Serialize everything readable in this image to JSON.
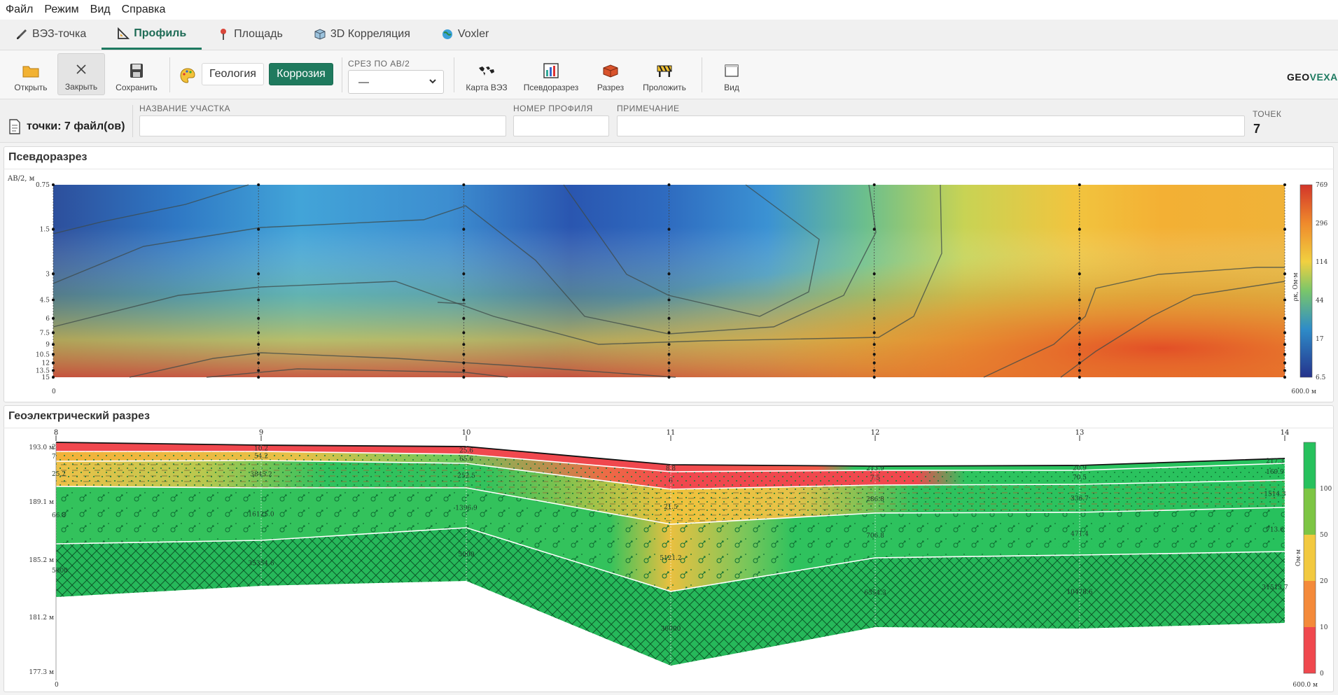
{
  "menu": [
    "Файл",
    "Режим",
    "Вид",
    "Справка"
  ],
  "tabs": [
    {
      "label": "ВЭЗ-точка",
      "icon": "brush-icon",
      "active": false
    },
    {
      "label": "Профиль",
      "icon": "triangle-ruler-icon",
      "active": true
    },
    {
      "label": "Площадь",
      "icon": "pin-icon",
      "active": false
    },
    {
      "label": "3D Корреляция",
      "icon": "cube-icon",
      "active": false
    },
    {
      "label": "Voxler",
      "icon": "globe-icon",
      "active": false
    }
  ],
  "toolbar": {
    "open": "Открыть",
    "close": "Закрыть",
    "save": "Сохранить",
    "geology": "Геология",
    "corrosion": "Коррозия",
    "srez_title": "СРЕЗ ПО AB/2",
    "srez_value": "—",
    "map": "Карта ВЭЗ",
    "pseudo": "Псевдоразрез",
    "razrez": "Разрез",
    "polozhit": "Проложить",
    "vid": "Вид"
  },
  "logo": {
    "a": "GEO",
    "b": "VEXA"
  },
  "info": {
    "points_label": "точки: 7 файл(ов)",
    "site_label": "НАЗВАНИЕ УЧАСТКА",
    "site_value": "",
    "profile_label": "НОМЕР ПРОФИЛЯ",
    "profile_value": "",
    "note_label": "ПРИМЕЧАНИЕ",
    "note_value": "",
    "count_label": "ТОЧЕК",
    "count_value": "7"
  },
  "colors": {
    "accent": "#1d7a60",
    "green": "#22c25e",
    "red": "#f0484e",
    "yellow": "#f2c940"
  },
  "pseudo": {
    "title": "Псевдоразрез",
    "y_axis_label": "AB/2, м",
    "y_ticks": [
      "0.75",
      "1.5",
      "3",
      "4.5",
      "6",
      "7.5",
      "9",
      "10.5",
      "12",
      "13.5",
      "15"
    ],
    "x_start": "0",
    "x_end": "600.0 м",
    "colorbar_ticks": [
      "769",
      "296",
      "114",
      "44",
      "17",
      "6.5"
    ],
    "colorbar_label": "ρк, Ом·м"
  },
  "geo": {
    "title": "Геоэлектрический разрез",
    "stations": [
      "8",
      "9",
      "10",
      "11",
      "12",
      "13",
      "14"
    ],
    "y_ticks": [
      "193.0 м",
      "189.1 м",
      "185.2 м",
      "181.2 м",
      "177.3 м"
    ],
    "x_start": "0",
    "x_end": "600.0 м",
    "legend_ticks": [
      "100",
      "50",
      "20",
      "10",
      "0"
    ],
    "legend_label": "Ом·м",
    "labels": [
      {
        "t": "10.2",
        "s": 1,
        "r": 0
      },
      {
        "t": "54.2",
        "s": 1,
        "r": 1
      },
      {
        "t": "3845.2",
        "s": 1,
        "r": 2
      },
      {
        "t": "16125.0",
        "s": 1,
        "r": 3
      },
      {
        "t": "35354.6",
        "s": 1,
        "r": 4
      },
      {
        "t": "25.6",
        "s": 2,
        "r": 0
      },
      {
        "t": "65.6",
        "s": 2,
        "r": 1
      },
      {
        "t": "252.5",
        "s": 2,
        "r": 2
      },
      {
        "t": "1396.9",
        "s": 2,
        "r": 3
      },
      {
        "t": "5000",
        "s": 2,
        "r": 4
      },
      {
        "t": "8.8",
        "s": 3,
        "r": 0
      },
      {
        "t": "6",
        "s": 3,
        "r": 1
      },
      {
        "t": "21.5",
        "s": 3,
        "r": 2
      },
      {
        "t": "5121.2",
        "s": 3,
        "r": 3
      },
      {
        "t": "36000",
        "s": 3,
        "r": 4
      },
      {
        "t": "213.9",
        "s": 4,
        "r": 0
      },
      {
        "t": "7.5",
        "s": 4,
        "r": 1
      },
      {
        "t": "286.8",
        "s": 4,
        "r": 2
      },
      {
        "t": "706.8",
        "s": 4,
        "r": 3
      },
      {
        "t": "6354.3",
        "s": 4,
        "r": 4
      },
      {
        "t": "20.9",
        "s": 5,
        "r": 0
      },
      {
        "t": "70.5",
        "s": 5,
        "r": 1
      },
      {
        "t": "336.7",
        "s": 5,
        "r": 2
      },
      {
        "t": "471.4",
        "s": 5,
        "r": 3
      },
      {
        "t": "10478.6",
        "s": 5,
        "r": 4
      },
      {
        "t": "217.3",
        "s": 6,
        "r": 0
      },
      {
        "t": "169.9",
        "s": 6,
        "r": 1
      },
      {
        "t": "1514.3",
        "s": 6,
        "r": 2
      },
      {
        "t": "713.6",
        "s": 6,
        "r": 3
      },
      {
        "t": "31513.7",
        "s": 6,
        "r": 4
      },
      {
        "t": "2",
        "s": 0,
        "r": 0
      },
      {
        "t": "7",
        "s": 0,
        "r": 1
      },
      {
        "t": "25.2",
        "s": 0,
        "r": 2
      },
      {
        "t": "66.8",
        "s": 0,
        "r": 3
      },
      {
        "t": "5000",
        "s": 0,
        "r": 4
      }
    ]
  }
}
